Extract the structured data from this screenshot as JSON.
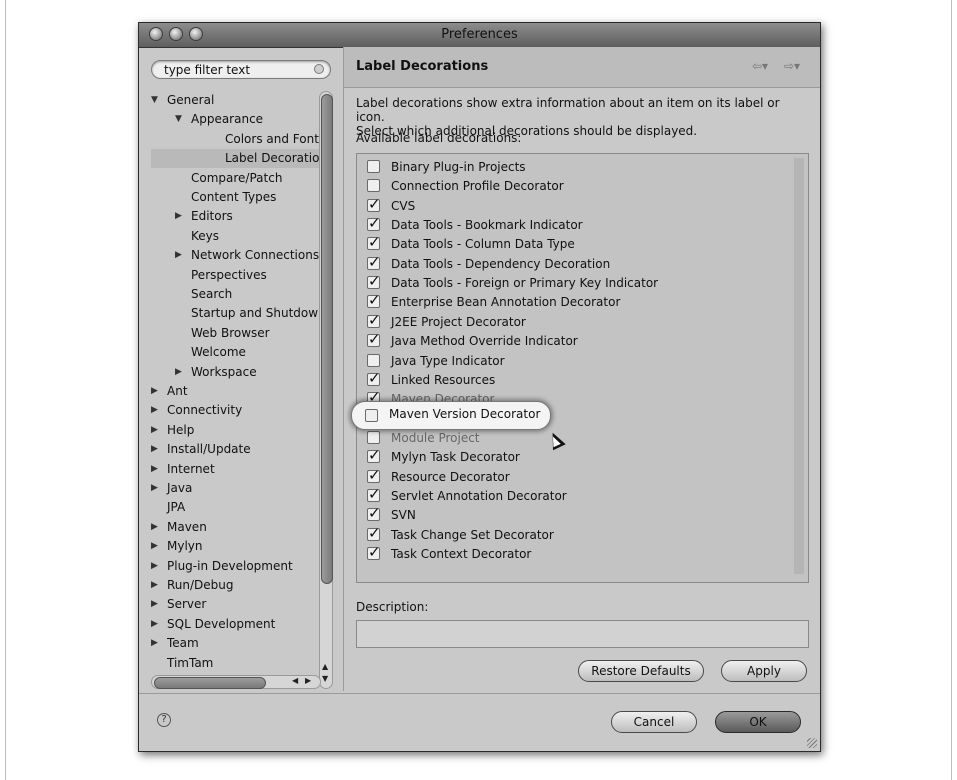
{
  "window": {
    "title": "Preferences"
  },
  "search": {
    "placeholder": "type filter text"
  },
  "tree": [
    {
      "label": "General",
      "level": 0,
      "arrow": "▼"
    },
    {
      "label": "Appearance",
      "level": 1,
      "arrow": "▼"
    },
    {
      "label": "Colors and Fonts",
      "level": 2,
      "arrow": ""
    },
    {
      "label": "Label Decorations",
      "level": 2,
      "arrow": "",
      "selected": true
    },
    {
      "label": "Compare/Patch",
      "level": 1,
      "arrow": ""
    },
    {
      "label": "Content Types",
      "level": 1,
      "arrow": ""
    },
    {
      "label": "Editors",
      "level": 1,
      "arrow": "▶"
    },
    {
      "label": "Keys",
      "level": 1,
      "arrow": ""
    },
    {
      "label": "Network Connections",
      "level": 1,
      "arrow": "▶"
    },
    {
      "label": "Perspectives",
      "level": 1,
      "arrow": ""
    },
    {
      "label": "Search",
      "level": 1,
      "arrow": ""
    },
    {
      "label": "Startup and Shutdown",
      "level": 1,
      "arrow": ""
    },
    {
      "label": "Web Browser",
      "level": 1,
      "arrow": ""
    },
    {
      "label": "Welcome",
      "level": 1,
      "arrow": ""
    },
    {
      "label": "Workspace",
      "level": 1,
      "arrow": "▶"
    },
    {
      "label": "Ant",
      "level": 0,
      "arrow": "▶"
    },
    {
      "label": "Connectivity",
      "level": 0,
      "arrow": "▶"
    },
    {
      "label": "Help",
      "level": 0,
      "arrow": "▶"
    },
    {
      "label": "Install/Update",
      "level": 0,
      "arrow": "▶"
    },
    {
      "label": "Internet",
      "level": 0,
      "arrow": "▶"
    },
    {
      "label": "Java",
      "level": 0,
      "arrow": "▶"
    },
    {
      "label": "JPA",
      "level": 0,
      "arrow": ""
    },
    {
      "label": "Maven",
      "level": 0,
      "arrow": "▶"
    },
    {
      "label": "Mylyn",
      "level": 0,
      "arrow": "▶"
    },
    {
      "label": "Plug-in Development",
      "level": 0,
      "arrow": "▶"
    },
    {
      "label": "Run/Debug",
      "level": 0,
      "arrow": "▶"
    },
    {
      "label": "Server",
      "level": 0,
      "arrow": "▶"
    },
    {
      "label": "SQL Development",
      "level": 0,
      "arrow": "▶"
    },
    {
      "label": "Team",
      "level": 0,
      "arrow": "▶"
    },
    {
      "label": "TimTam",
      "level": 0,
      "arrow": ""
    }
  ],
  "page": {
    "title": "Label Decorations",
    "description_lines": [
      "Label decorations show extra information about an item on its label or icon.",
      "Select which additional decorations should be displayed."
    ],
    "available_label": "Available label decorations:",
    "description_label": "Description:"
  },
  "decorations": [
    {
      "label": "Binary Plug-in Projects",
      "checked": false
    },
    {
      "label": "Connection Profile Decorator",
      "checked": false
    },
    {
      "label": "CVS",
      "checked": true
    },
    {
      "label": "Data Tools - Bookmark Indicator",
      "checked": true
    },
    {
      "label": "Data Tools - Column Data Type",
      "checked": true
    },
    {
      "label": "Data Tools - Dependency Decoration",
      "checked": true
    },
    {
      "label": "Data Tools - Foreign or Primary Key Indicator",
      "checked": true
    },
    {
      "label": "Enterprise Bean Annotation Decorator",
      "checked": true
    },
    {
      "label": "J2EE Project Decorator",
      "checked": true
    },
    {
      "label": "Java Method Override Indicator",
      "checked": true
    },
    {
      "label": "Java Type Indicator",
      "checked": false
    },
    {
      "label": "Linked Resources",
      "checked": true
    },
    {
      "label": "Maven Decorator",
      "checked": true,
      "dim": true
    },
    {
      "label": "Maven Version Decorator",
      "checked": false,
      "hidden": true
    },
    {
      "label": "Module Project",
      "checked": false,
      "dim": true
    },
    {
      "label": "Mylyn Task Decorator",
      "checked": true
    },
    {
      "label": "Resource Decorator",
      "checked": true
    },
    {
      "label": "Servlet Annotation Decorator",
      "checked": true
    },
    {
      "label": "SVN",
      "checked": true
    },
    {
      "label": "Task Change Set Decorator",
      "checked": true
    },
    {
      "label": "Task Context Decorator",
      "checked": true
    }
  ],
  "callout": {
    "label": "Maven Version Decorator",
    "checked": false
  },
  "buttons": {
    "restore_defaults": "Restore Defaults",
    "apply": "Apply",
    "cancel": "Cancel",
    "ok": "OK",
    "help": "?"
  }
}
